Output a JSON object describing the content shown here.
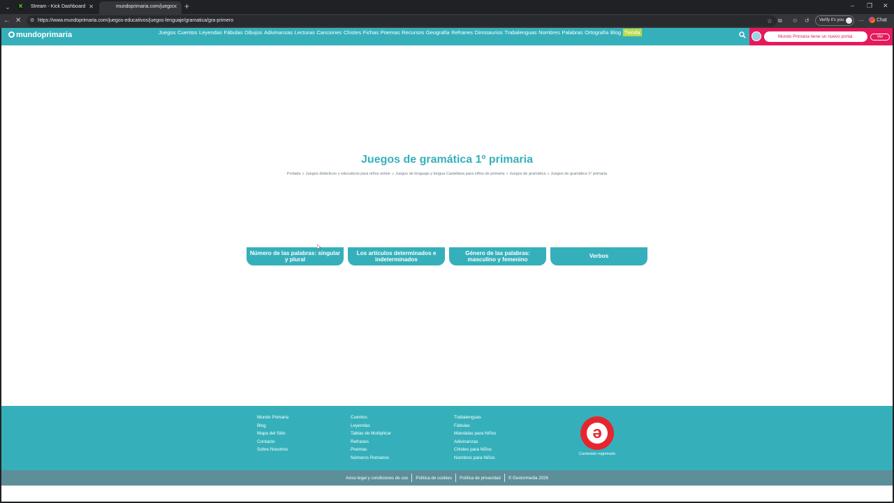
{
  "browser": {
    "tabs": [
      {
        "title": "Stream - Kick Dashboard",
        "favicon": "K"
      },
      {
        "title": "mundoprimaria.com/juegos-educ"
      }
    ],
    "url": "https://www.mundoprimaria.com/juegos-educativos/juegos-lenguaje/gramatica/gra-primero",
    "verify_label": "Verify it's you",
    "chat_label": "Chat"
  },
  "site": {
    "logo": "mundoprimaria",
    "menu": [
      "Juegos",
      "Cuentos",
      "Leyendas",
      "Fábulas",
      "Dibujos",
      "Adivinanzas",
      "Lecturas",
      "Canciones",
      "Chistes",
      "Fichas",
      "Poemas",
      "Recursos",
      "Geografía",
      "Refranes",
      "Dinosaurios",
      "Trabalenguas",
      "Nombres",
      "Palabras",
      "Ortografía",
      "Blog",
      "Tienda"
    ],
    "promo_text": "Mundo Primaria tiene un nuevo portal.",
    "promo_button": "Ver"
  },
  "main": {
    "title": "Juegos de gramática 1º primaria",
    "breadcrumbs": [
      "Portada",
      "Juegos didácticos y educativos para niños online",
      "Juegos de lenguaje y lengua Castellana para niños de primaria",
      "Juegos de gramática",
      "Juegos de gramática 1º primaria"
    ],
    "breadcrumb_separator": "»",
    "cards": [
      "Número de las palabras: singular y plural",
      "Los artículos determinados e indeterminados",
      "Género de las palabras: masculino y femenino",
      "Verbos"
    ]
  },
  "footer": {
    "col1": [
      "Mundo Primaria",
      "Blog",
      "Mapa del Sitio",
      "Contacto",
      "Sobre Nosotros"
    ],
    "col2": [
      "Cuentos",
      "Leyendas",
      "Tablas de Multiplicar",
      "Refranes",
      "Poemas",
      "Números Romanos"
    ],
    "col3": [
      "Trabalenguas",
      "Fábulas",
      "Mandalas para Niños",
      "Adivinanzas",
      "Chistes para Niños",
      "Nombres para Niños"
    ],
    "registered_label": "Contenido registrado",
    "legal": [
      "Aviso legal y condiciones de uso",
      "Política de cookies",
      "Política de privacidad",
      "© Gestormedia 2026"
    ]
  },
  "colors": {
    "brand": "#35b0bb",
    "promo": "#e6195c",
    "tienda": "#b9d94a",
    "legal_bar": "#5d8f99"
  }
}
